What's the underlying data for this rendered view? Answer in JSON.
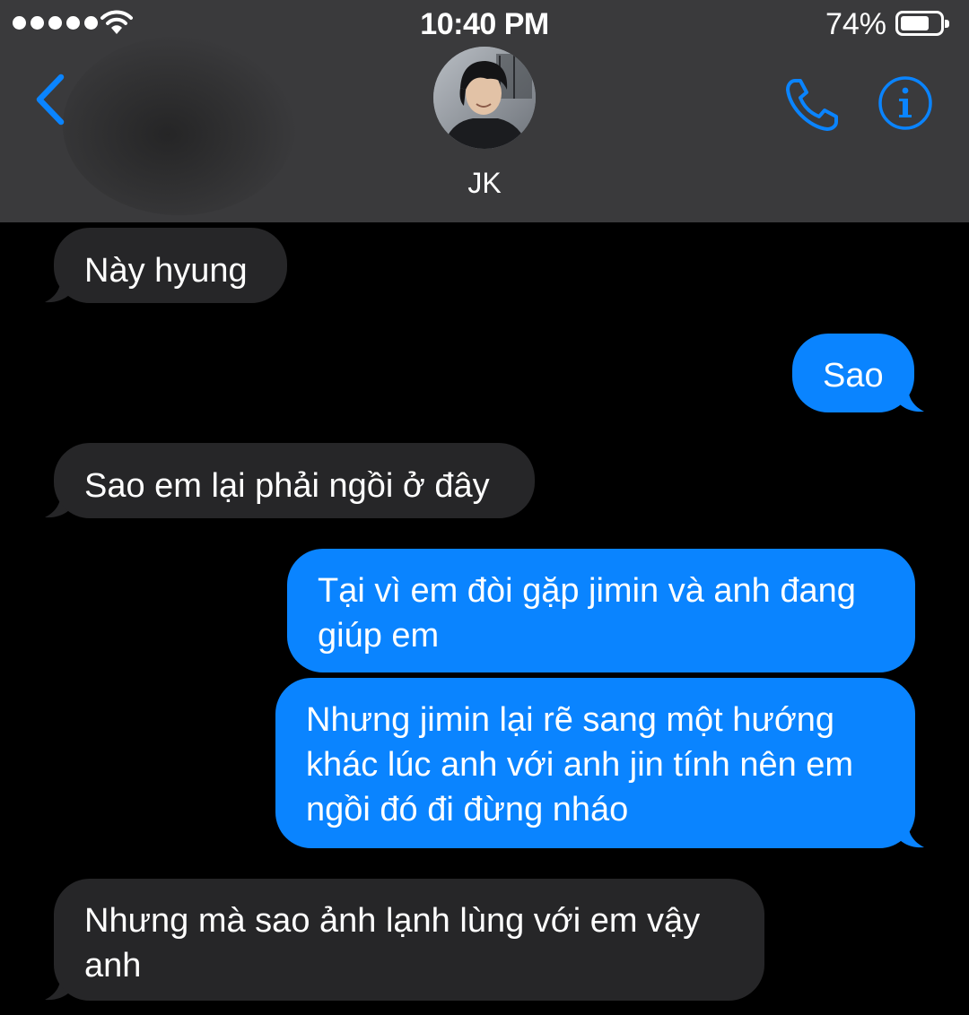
{
  "status_bar": {
    "time": "10:40 PM",
    "battery_percent": "74%",
    "battery_level": 0.74,
    "signal_bars": 5,
    "icons": [
      "signal-dots-icon",
      "wifi-icon",
      "battery-icon"
    ]
  },
  "header": {
    "contact_name": "JK",
    "icons": [
      "back-chevron-icon",
      "phone-icon",
      "info-icon"
    ]
  },
  "colors": {
    "header_bg": "#3a3a3c",
    "incoming_bubble": "#262628",
    "outgoing_bubble": "#0a84ff",
    "accent": "#0a84ff",
    "background": "#000000"
  },
  "messages": [
    {
      "direction": "incoming",
      "text": "Này hyung"
    },
    {
      "direction": "outgoing",
      "text": "Sao"
    },
    {
      "direction": "incoming",
      "text": "Sao em lại phải ngồi ở đây"
    },
    {
      "direction": "outgoing",
      "text": "Tại vì em đòi gặp jimin và anh đang giúp em"
    },
    {
      "direction": "outgoing",
      "text": "Nhưng jimin lại rẽ sang một hướng khác lúc anh với anh jin tính nên em ngồi đó đi đừng nháo"
    },
    {
      "direction": "incoming",
      "text": "Nhưng mà sao ảnh lạnh lùng với em vậy anh"
    }
  ]
}
